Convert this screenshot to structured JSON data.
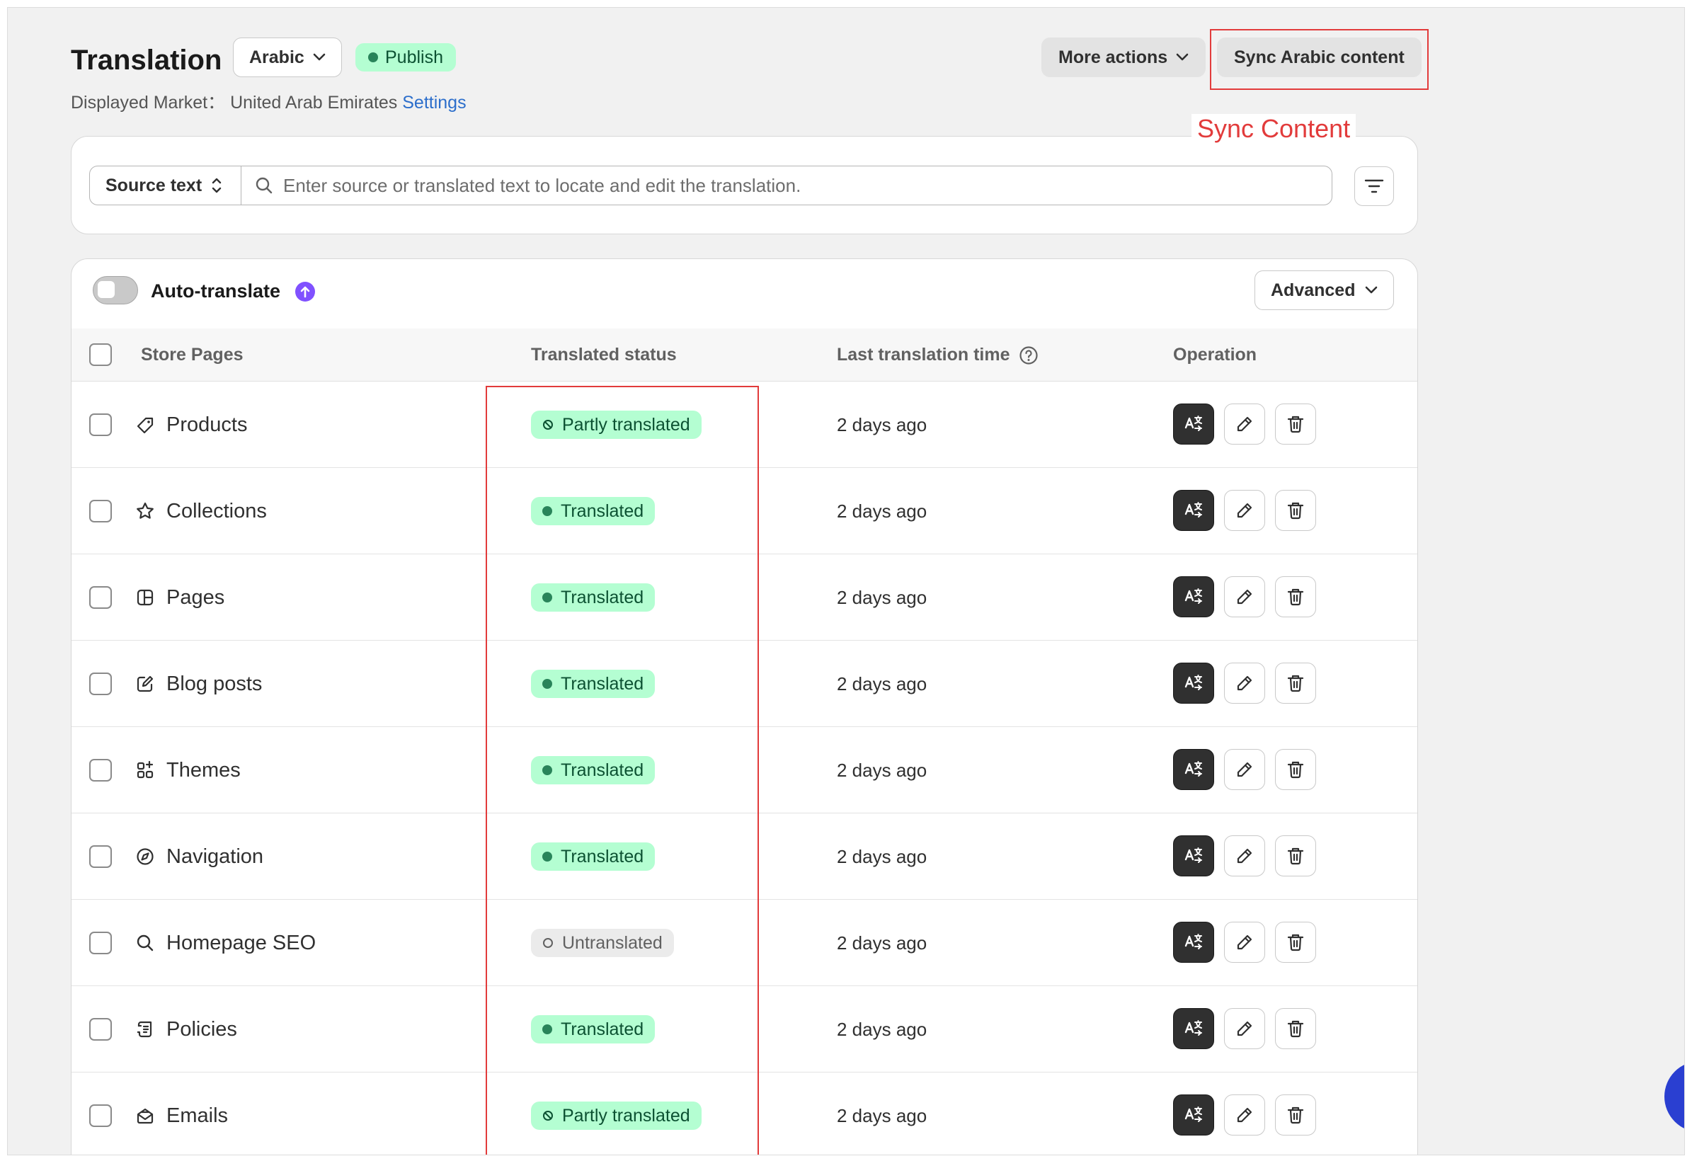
{
  "header": {
    "title": "Translation",
    "language": "Arabic",
    "publish_label": "Publish",
    "market_prefix": "Displayed Market： United Arab Emirates",
    "settings_link": "Settings",
    "more_actions": "More actions",
    "sync_button": "Sync Arabic content",
    "annotation": "Sync Content"
  },
  "search": {
    "source_select": "Source text",
    "placeholder": "Enter source or translated text to locate and edit the translation."
  },
  "toolbar": {
    "auto_translate": "Auto-translate",
    "advanced": "Advanced"
  },
  "table": {
    "columns": {
      "page": "Store Pages",
      "status": "Translated status",
      "time": "Last translation time",
      "operation": "Operation"
    },
    "rows": [
      {
        "name": "Products",
        "icon": "tag-icon",
        "status": "Partly translated",
        "kind": "partial",
        "time": "2 days ago"
      },
      {
        "name": "Collections",
        "icon": "star-icon",
        "status": "Translated",
        "kind": "full",
        "time": "2 days ago"
      },
      {
        "name": "Pages",
        "icon": "layout-icon",
        "status": "Translated",
        "kind": "full",
        "time": "2 days ago"
      },
      {
        "name": "Blog posts",
        "icon": "compose-icon",
        "status": "Translated",
        "kind": "full",
        "time": "2 days ago"
      },
      {
        "name": "Themes",
        "icon": "apps-icon",
        "status": "Translated",
        "kind": "full",
        "time": "2 days ago"
      },
      {
        "name": "Navigation",
        "icon": "compass-icon",
        "status": "Translated",
        "kind": "full",
        "time": "2 days ago"
      },
      {
        "name": "Homepage SEO",
        "icon": "search-icon",
        "status": "Untranslated",
        "kind": "none",
        "time": "2 days ago"
      },
      {
        "name": "Policies",
        "icon": "receipt-icon",
        "status": "Translated",
        "kind": "full",
        "time": "2 days ago"
      },
      {
        "name": "Emails",
        "icon": "email-icon",
        "status": "Partly translated",
        "kind": "partial",
        "time": "2 days ago"
      }
    ]
  },
  "colors": {
    "annotation_red": "#e23b3b",
    "success_bg": "#b4fed2",
    "success_text": "#0c5132",
    "accent_purple": "#8051ff"
  }
}
